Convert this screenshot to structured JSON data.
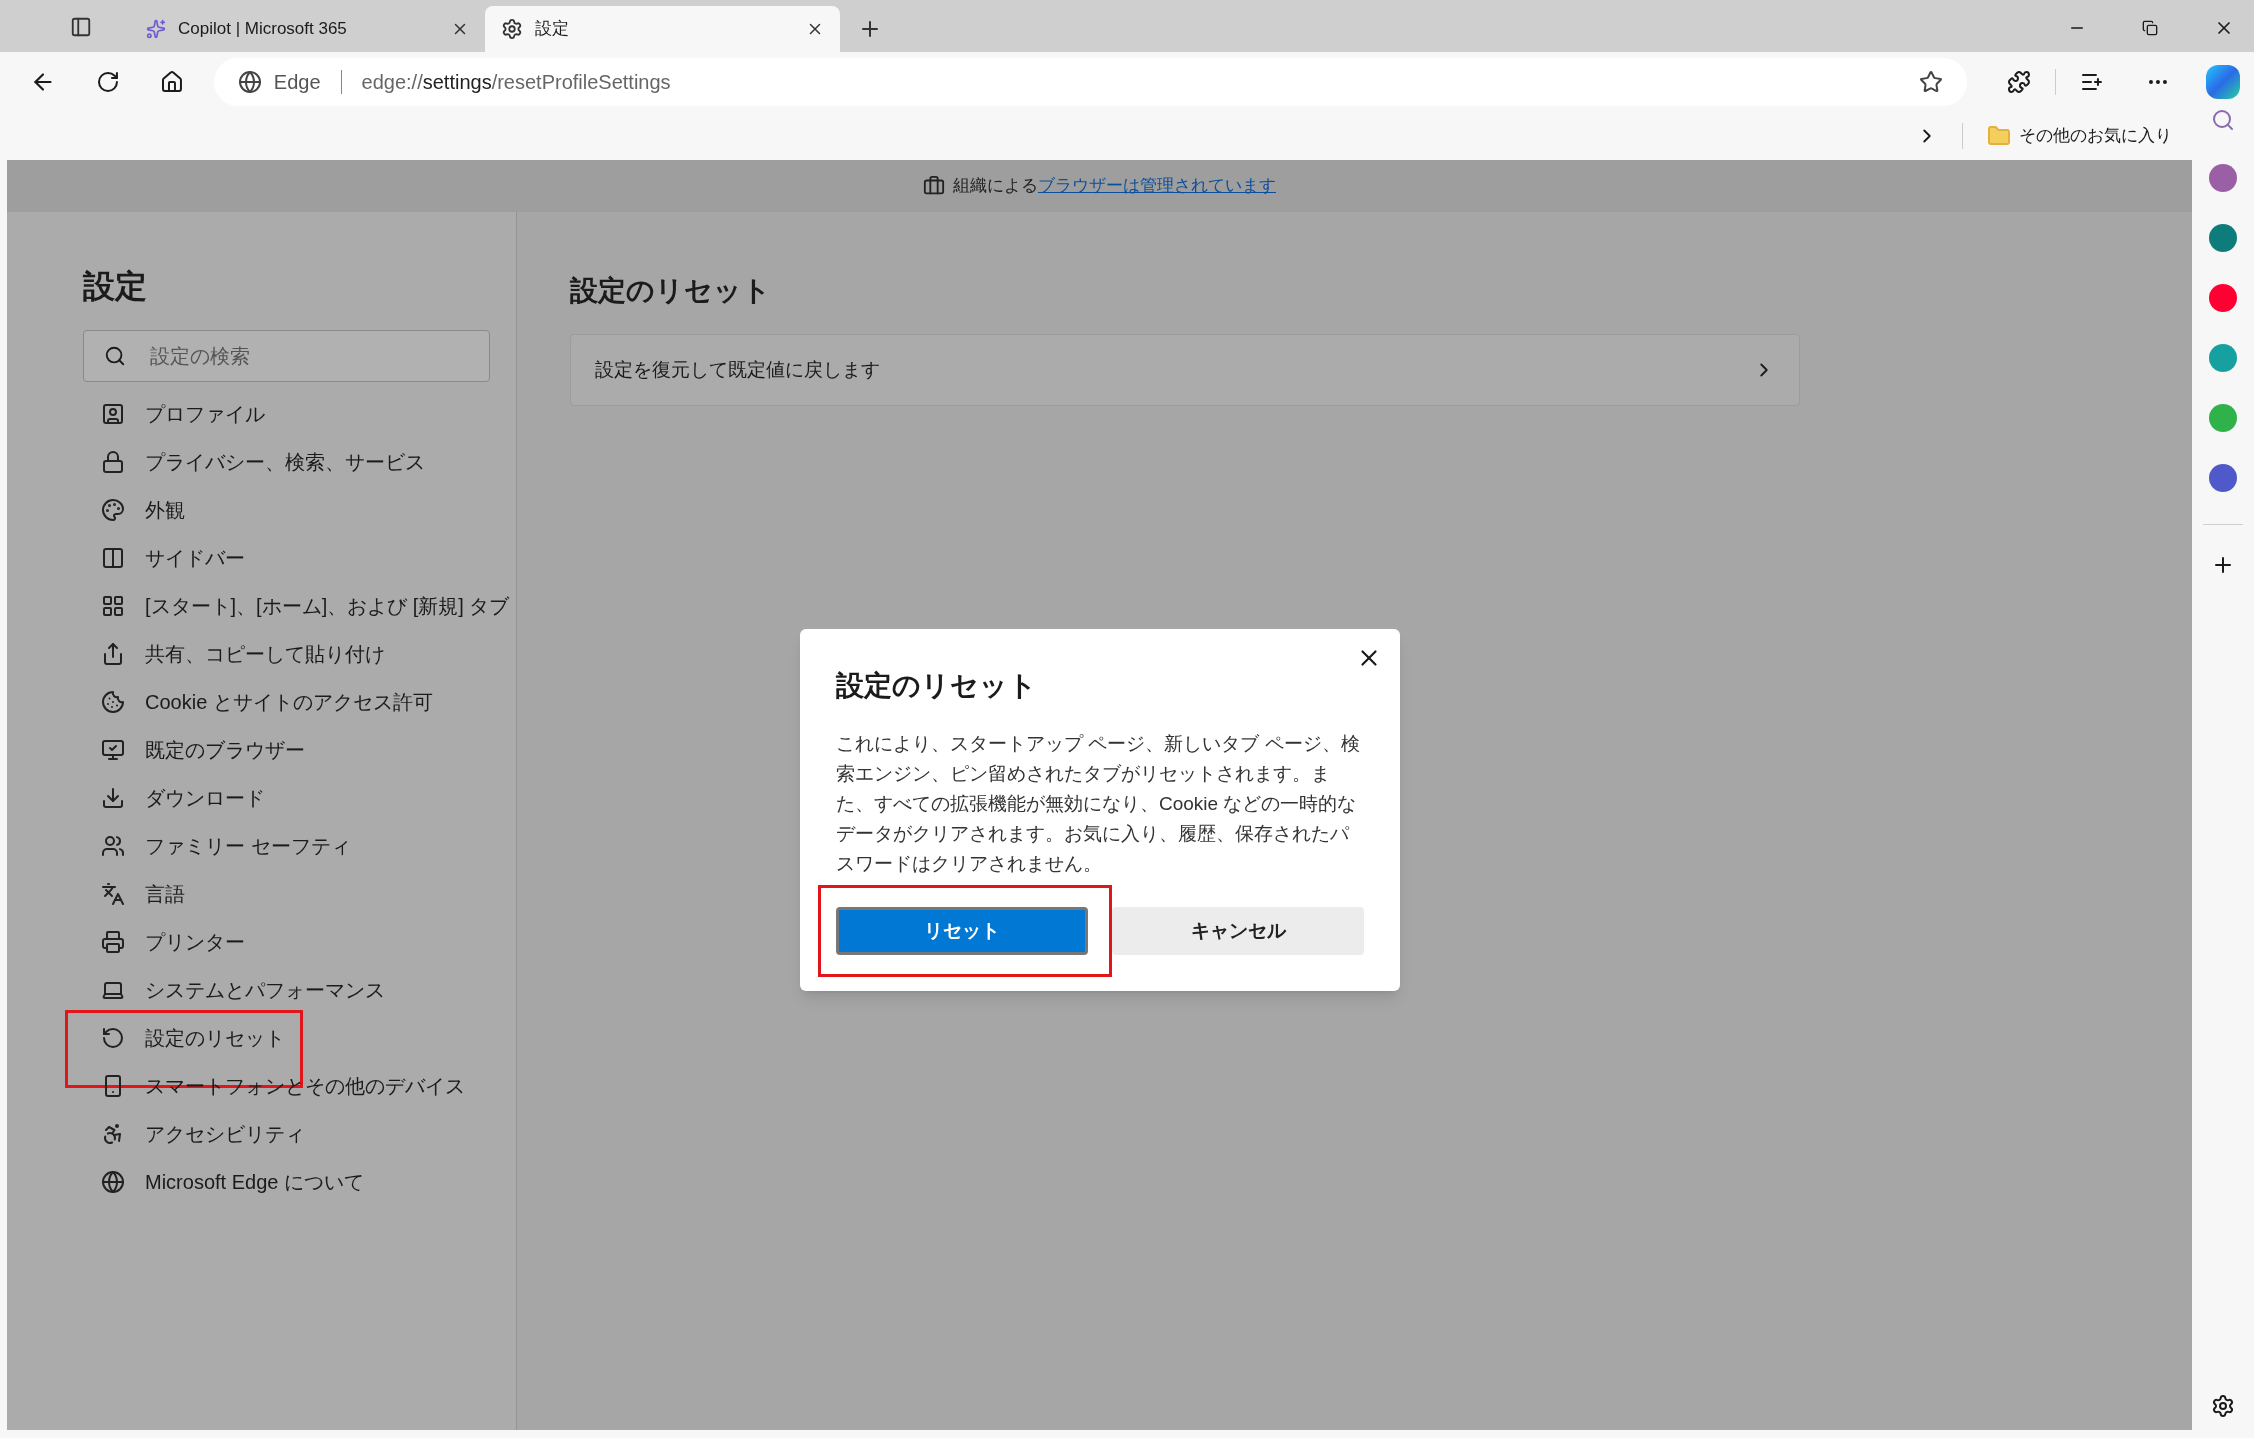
{
  "tabs": [
    {
      "title": "Copilot | Microsoft 365",
      "selected": false
    },
    {
      "title": "設定",
      "selected": true
    }
  ],
  "address_bar": {
    "site_label": "Edge",
    "url_prefix": "edge://",
    "url_host": "settings",
    "url_path": "/resetProfileSettings"
  },
  "favorites_bar": {
    "folder": "その他のお気に入り"
  },
  "managed_banner": {
    "text": "組織による",
    "link": "ブラウザーは管理されています"
  },
  "settings_nav": {
    "title": "設定",
    "search_placeholder": "設定の検索",
    "items": [
      {
        "label": "プロファイル",
        "highlighted": false
      },
      {
        "label": "プライバシー、検索、サービス",
        "highlighted": false
      },
      {
        "label": "外観",
        "highlighted": false
      },
      {
        "label": "サイドバー",
        "highlighted": false
      },
      {
        "label": "[スタート]、[ホーム]、および [新規] タブ",
        "highlighted": false
      },
      {
        "label": "共有、コピーして貼り付け",
        "highlighted": false
      },
      {
        "label": "Cookie とサイトのアクセス許可",
        "highlighted": false
      },
      {
        "label": "既定のブラウザー",
        "highlighted": false
      },
      {
        "label": "ダウンロード",
        "highlighted": false
      },
      {
        "label": "ファミリー セーフティ",
        "highlighted": false
      },
      {
        "label": "言語",
        "highlighted": false
      },
      {
        "label": "プリンター",
        "highlighted": false
      },
      {
        "label": "システムとパフォーマンス",
        "highlighted": false
      },
      {
        "label": "設定のリセット",
        "highlighted": true
      },
      {
        "label": "スマートフォンとその他のデバイス",
        "highlighted": false
      },
      {
        "label": "アクセシビリティ",
        "highlighted": false
      },
      {
        "label": "Microsoft Edge について",
        "highlighted": false
      }
    ]
  },
  "page": {
    "title": "設定のリセット",
    "rows": [
      {
        "label": "設定を復元して既定値に戻します"
      }
    ]
  },
  "dialog": {
    "title": "設定のリセット",
    "body": "これにより、スタートアップ ページ、新しいタブ ページ、検索エンジン、ピン留めされたタブがリセットされます。また、すべての拡張機能が無効になり、Cookie などの一時的なデータがクリアされます。お気に入り、履歴、保存されたパスワードはクリアされません。",
    "buttons": [
      {
        "label": "リセット",
        "kind": "primary",
        "highlighted": true
      },
      {
        "label": "キャンセル",
        "kind": "secondary",
        "highlighted": false
      }
    ]
  }
}
